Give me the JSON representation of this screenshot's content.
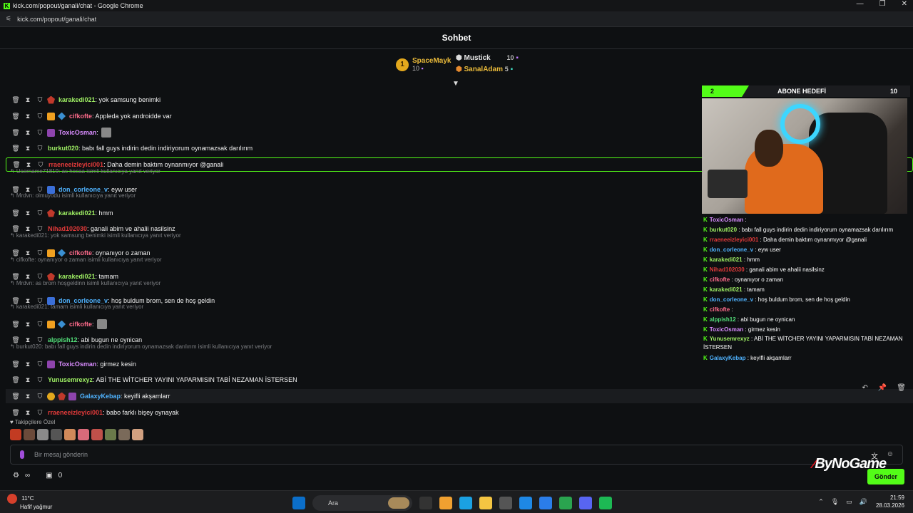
{
  "window": {
    "title": "kick.com/popout/ganali/chat - Google Chrome",
    "url": "kick.com/popout/ganali/chat",
    "controls": [
      "—",
      "❐",
      "✕"
    ]
  },
  "header": {
    "title": "Sohbet"
  },
  "top_gifters": [
    {
      "rank": "1",
      "name": "SpaceMayk",
      "amount": "10",
      "color": "#e8b93a"
    },
    {
      "name": "Mustick",
      "amount": "10",
      "color": "#ffffff"
    },
    {
      "name": "SanalAdam",
      "amount": "5",
      "color": "#e8b93a"
    }
  ],
  "messages": [
    {
      "kind": "msg",
      "badges": [
        "vip"
      ],
      "user": "karakedi021",
      "user_color": "#9ff064",
      "text": ": yok samsung benimki"
    },
    {
      "kind": "msg",
      "badges": [
        "crown",
        "diamond"
      ],
      "user": "cifkofte",
      "user_color": "#ff6b8b",
      "text": ": Appleda yok androidde var"
    },
    {
      "kind": "msg",
      "badges": [
        "purple"
      ],
      "user": "ToxicOsman",
      "user_color": "#d98cff",
      "text": ":",
      "emote": true
    },
    {
      "kind": "msg",
      "badges": [],
      "user": "burkut020",
      "user_color": "#9ff064",
      "text": ": babı fall guys indirin dedin indiriyorum oynamazsak darılırım"
    },
    {
      "kind": "msg",
      "badges": [],
      "user": "rraeneeizleyici001",
      "user_color": "#e23a3a",
      "text": ": Daha demin baktım oynanmıyor @ganali",
      "highlight": true
    },
    {
      "kind": "reply",
      "text": "Username71819: as hocaa isimli kullanıcıya yanıt veriyor"
    },
    {
      "kind": "msg",
      "badges": [
        "blue"
      ],
      "user": "don_corleone_v",
      "user_color": "#4fb3ff",
      "text": ": eyw user"
    },
    {
      "kind": "reply",
      "text": "Mrdvn: olmuyodu isimli kullanıcıya yanıt veriyor"
    },
    {
      "kind": "msg",
      "badges": [
        "vip"
      ],
      "user": "karakedi021",
      "user_color": "#9ff064",
      "text": ": hmm"
    },
    {
      "kind": "msg",
      "badges": [],
      "user": "Nihad102030",
      "user_color": "#e23a3a",
      "text": ": ganali abim ve ahalii nasilsinz"
    },
    {
      "kind": "reply",
      "text": "karakedi021: yok samsung benimki isimli kullanıcıya yanıt veriyor"
    },
    {
      "kind": "msg",
      "badges": [
        "crown",
        "diamond"
      ],
      "user": "cifkofte",
      "user_color": "#ff6b8b",
      "text": ": oynanıyor o zaman"
    },
    {
      "kind": "reply",
      "text": "cifkofte: oynanıyor o zaman isimli kullanıcıya yanıt veriyor"
    },
    {
      "kind": "msg",
      "badges": [
        "vip"
      ],
      "user": "karakedi021",
      "user_color": "#9ff064",
      "text": ": tamam"
    },
    {
      "kind": "reply",
      "text": "Mrdvn: as brom hoşgeldinn isimli kullanıcıya yanıt veriyor"
    },
    {
      "kind": "msg",
      "badges": [
        "blue"
      ],
      "user": "don_corleone_v",
      "user_color": "#4fb3ff",
      "text": ": hoş buldum brom, sen de hoş geldin"
    },
    {
      "kind": "reply",
      "text": "karakedi021: tamam isimli kullanıcıya yanıt veriyor"
    },
    {
      "kind": "msg",
      "badges": [
        "crown",
        "diamond"
      ],
      "user": "cifkofte",
      "user_color": "#ff6b8b",
      "text": ":",
      "emote": true
    },
    {
      "kind": "msg",
      "badges": [],
      "user": "alppish12",
      "user_color": "#53e07a",
      "text": ": abi bugun ne oynican"
    },
    {
      "kind": "reply",
      "text": "burkut020: babı fall guys indirin dedin indiriyorum oynamazsak darılırım isimli kullanıcıya yanıt veriyor"
    },
    {
      "kind": "msg",
      "badges": [
        "purple"
      ],
      "user": "ToxicOsman",
      "user_color": "#d98cff",
      "text": ": girmez kesin"
    },
    {
      "kind": "msg",
      "badges": [],
      "user": "Yunusemrexyz",
      "user_color": "#9ff064",
      "text": ": ABİ THE WİTCHER YAYINI YAPARMISIN TABİ NEZAMAN İSTERSEN"
    },
    {
      "kind": "msg",
      "badges": [
        "gold",
        "vip",
        "purple"
      ],
      "user": "GalaxyKebap",
      "user_color": "#4fb3ff",
      "text": ": keyifli akşamlarr",
      "hover": true
    },
    {
      "kind": "msg",
      "badges": [],
      "user": "rraeneeizleyici001",
      "user_color": "#e23a3a",
      "text": ": babo farklı bişey oynayak"
    }
  ],
  "row_actions": [
    "↶",
    "📌",
    "🗑"
  ],
  "followers_label": "Takipçilere Özel",
  "emote_colors": [
    "#c23b22",
    "#6b4a3a",
    "#8a8a8a",
    "#555",
    "#d18a5a",
    "#d96a7a",
    "#c0504a",
    "#6a7a4a",
    "#7a6a5a",
    "#d0a080"
  ],
  "input": {
    "placeholder": "Bir mesaj gönderin"
  },
  "bottom": {
    "infinity": "∞",
    "count": "0"
  },
  "send_label": "Gönder",
  "brand": "ByNoGame",
  "overlay": {
    "goal_count": "2",
    "goal_label": "ABONE HEDEFİ",
    "goal_total": "10",
    "lines": [
      {
        "user": "ToxicOsman",
        "color": "#d98cff",
        "text": " :"
      },
      {
        "user": "burkut020",
        "color": "#9ff064",
        "text": " : babı fall guys indirin dedin indiriyorum oynamazsak darılırım"
      },
      {
        "user": "rraeneeizleyici001",
        "color": "#e23a3a",
        "text": " : Daha demin baktım oynanmıyor @ganali"
      },
      {
        "user": "don_corleone_v",
        "color": "#4fb3ff",
        "text": " : eyw user"
      },
      {
        "user": "karakedi021",
        "color": "#9ff064",
        "text": " : hmm"
      },
      {
        "user": "Nihad102030",
        "color": "#e23a3a",
        "text": " : ganali abim ve ahalii nasilsinz"
      },
      {
        "user": "cifkofte",
        "color": "#ff6b8b",
        "text": " : oynanıyor o zaman"
      },
      {
        "user": "karakedi021",
        "color": "#9ff064",
        "text": " : tamam"
      },
      {
        "user": "don_corleone_v",
        "color": "#4fb3ff",
        "text": " : hoş buldum brom, sen de hoş geldin"
      },
      {
        "user": "cifkofte",
        "color": "#ff6b8b",
        "text": " :"
      },
      {
        "user": "alppish12",
        "color": "#53e07a",
        "text": " : abi bugun ne oynican"
      },
      {
        "user": "ToxicOsman",
        "color": "#d98cff",
        "text": " : girmez kesin"
      },
      {
        "user": "Yunusemrexyz",
        "color": "#9ff064",
        "text": " : ABİ THE WİTCHER YAYINI YAPARMISIN TABİ NEZAMAN İSTERSEN",
        "wrap": true
      },
      {
        "user": "GalaxyKebap",
        "color": "#4fb3ff",
        "text": " : keyifli akşamlarr"
      }
    ]
  },
  "taskbar": {
    "temp": "11°C",
    "weather": "Hafif yağmur",
    "search": "Ara",
    "time": "21:59",
    "date": "28.03.2026",
    "app_colors": [
      "#0b6ec9",
      "#333",
      "#f0a030",
      "#1ba1e2",
      "#f4c542",
      "#555",
      "#1e88e5",
      "#2b7de9",
      "#2aa44f",
      "#5865f2",
      "#1db954"
    ]
  }
}
